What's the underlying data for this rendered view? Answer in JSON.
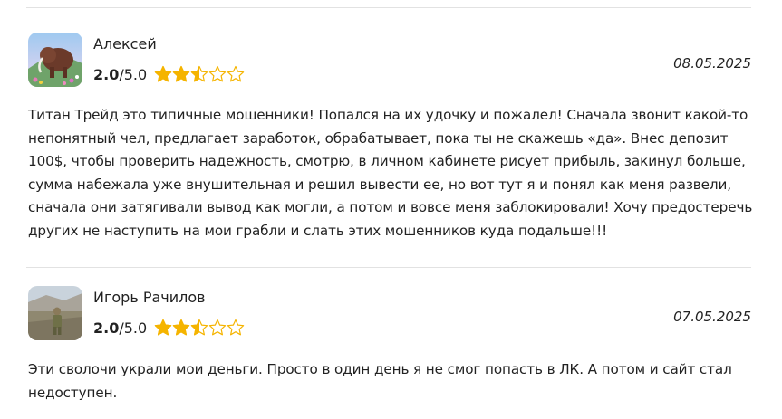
{
  "reviews": [
    {
      "author": "Алексей",
      "score": "2.0",
      "max": "/5.0",
      "stars_filled": 2.5,
      "stars_total": 5,
      "date": "08.05.2025",
      "text": "Титан Трейд это типичные мошенники! Попался на их удочку и пожалел! Сначала звонит какой-то непонятный чел, предлагает заработок, обрабатывает, пока ты не скажешь «да». Внес депозит 100$, чтобы проверить надежность, смотрю, в личном кабинете рисует прибыль, закинул больше, сумма набежала уже внушительная и решил вывести ее, но вот тут я и понял как меня развели, сначала они затягивали вывод как могли, а потом и вовсе меня заблокировали! Хочу предостеречь других не наступить на мои грабли и слать этих мошенников куда подальше!!!"
    },
    {
      "author": "Игорь Рачилов",
      "score": "2.0",
      "max": "/5.0",
      "stars_filled": 2.5,
      "stars_total": 5,
      "date": "07.05.2025",
      "text": "Эти сволочи украли мои деньги. Просто в один день я не смог попасть в ЛК. А потом и сайт стал недоступен."
    }
  ],
  "colors": {
    "star": "#f5b400",
    "divider": "#e2e2e2"
  }
}
